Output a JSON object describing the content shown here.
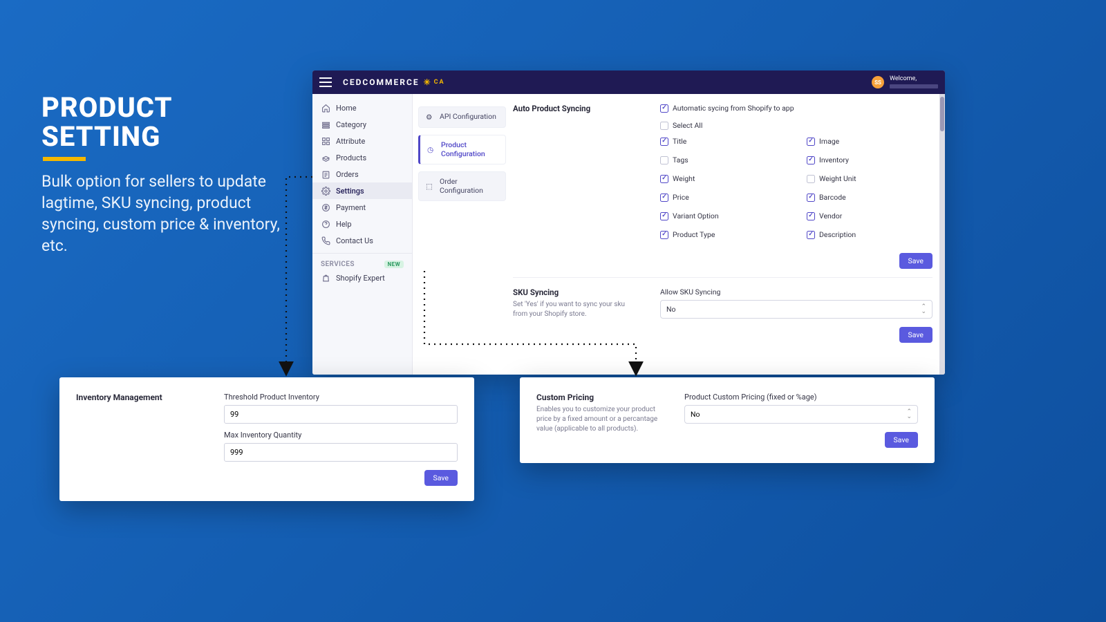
{
  "hero": {
    "title": "PRODUCT SETTING",
    "desc": "Bulk option for sellers to update lagtime, SKU syncing, product syncing, custom price & inventory, etc."
  },
  "topbar": {
    "brand": "CEDCOMMERCE",
    "sub": "CA",
    "avatar_initials": "SS",
    "welcome": "Welcome,"
  },
  "sidebar": {
    "items": [
      {
        "label": "Home",
        "icon": "home"
      },
      {
        "label": "Category",
        "icon": "category"
      },
      {
        "label": "Attribute",
        "icon": "attribute"
      },
      {
        "label": "Products",
        "icon": "products"
      },
      {
        "label": "Orders",
        "icon": "orders"
      },
      {
        "label": "Settings",
        "icon": "settings",
        "active": true
      },
      {
        "label": "Payment",
        "icon": "payment"
      },
      {
        "label": "Help",
        "icon": "help"
      },
      {
        "label": "Contact Us",
        "icon": "contact"
      }
    ],
    "services_label": "SERVICES",
    "new_badge": "NEW",
    "shopify_expert": "Shopify Expert"
  },
  "subnav": {
    "api": "API Configuration",
    "product": "Product Configuration",
    "order": "Order Configuration"
  },
  "auto_sync": {
    "title": "Auto Product Syncing",
    "auto_label": "Automatic sycing from Shopify to app",
    "select_all": "Select All",
    "opts": {
      "title": "Title",
      "image": "Image",
      "tags": "Tags",
      "inventory": "Inventory",
      "weight": "Weight",
      "weight_unit": "Weight Unit",
      "price": "Price",
      "barcode": "Barcode",
      "variant": "Variant Option",
      "vendor": "Vendor",
      "ptype": "Product Type",
      "desc": "Description"
    },
    "save": "Save"
  },
  "sku": {
    "title": "SKU Syncing",
    "desc": "Set 'Yes' if you want to sync your sku from your Shopify store.",
    "label": "Allow SKU Syncing",
    "value": "No",
    "save": "Save"
  },
  "inventory_popup": {
    "title": "Inventory Management",
    "threshold_label": "Threshold Product Inventory",
    "threshold_value": "99",
    "max_label": "Max Inventory Quantity",
    "max_value": "999",
    "save": "Save"
  },
  "pricing_popup": {
    "title": "Custom Pricing",
    "desc": "Enables you to customize your product price by a fixed amount or a percantage value (applicable to all products).",
    "label": "Product Custom Pricing (fixed or %age)",
    "value": "No",
    "save": "Save"
  }
}
